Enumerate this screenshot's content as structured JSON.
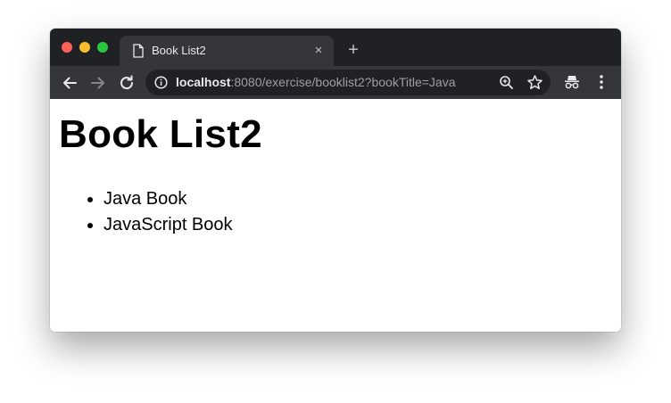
{
  "browser": {
    "tab": {
      "title": "Book List2",
      "icon": "document-icon",
      "close": "×"
    },
    "new_tab": "+",
    "address": {
      "host": "localhost",
      "rest": ":8080/exercise/booklist2?bookTitle=Java"
    },
    "icons": [
      "back-arrow-icon",
      "forward-arrow-icon",
      "reload-icon",
      "info-icon",
      "zoom-icon",
      "star-icon",
      "incognito-icon",
      "menu-icon"
    ],
    "colors": {
      "frame": "#202124",
      "toolbar": "#35363a",
      "close_light": "#ff5f57",
      "minimize_light": "#febc2e",
      "maximize_light": "#28c840"
    }
  },
  "page": {
    "heading": "Book List2",
    "books": [
      "Java Book",
      "JavaScript Book"
    ]
  }
}
